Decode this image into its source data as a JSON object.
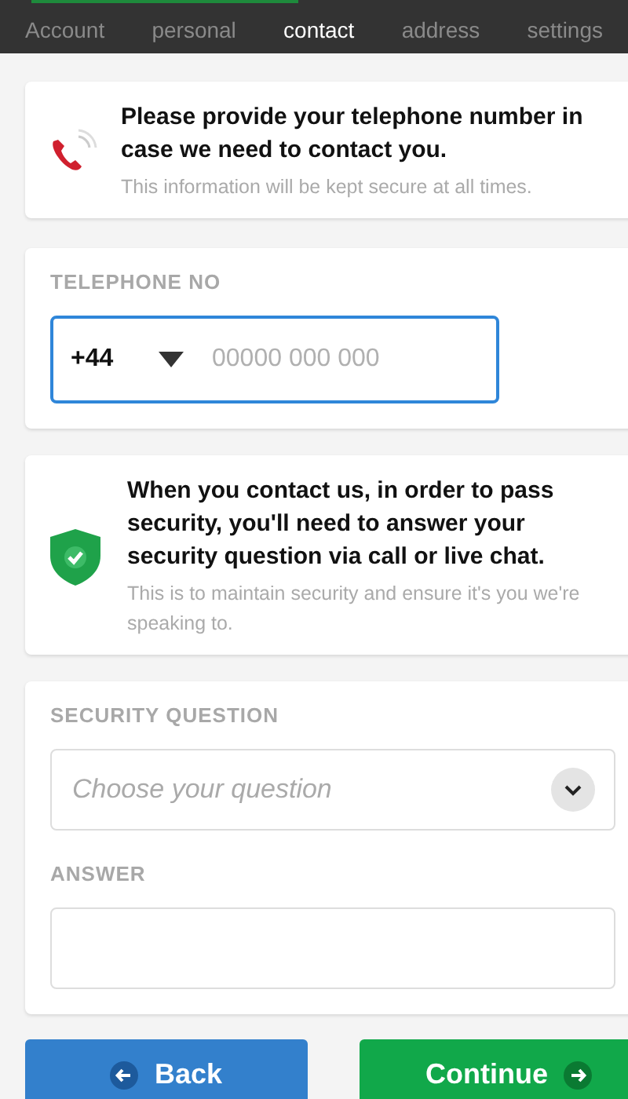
{
  "tabs": [
    {
      "label": "Account",
      "selected": false
    },
    {
      "label": "personal",
      "selected": false
    },
    {
      "label": "contact",
      "selected": true
    },
    {
      "label": "address",
      "selected": false
    },
    {
      "label": "settings",
      "selected": false
    }
  ],
  "phone_notice": {
    "title": "Please provide your telephone number in case we need to contact you.",
    "subtitle": "This information will be kept secure at all times."
  },
  "telephone": {
    "label": "TELEPHONE NO",
    "country_code": "+44",
    "placeholder": "00000 000 000",
    "focused": true
  },
  "security_notice": {
    "title": "When you contact us, in order to pass security, you'll need to answer your security question via call or live chat.",
    "subtitle": "This is to maintain security and ensure it's you we're speaking to."
  },
  "security_question": {
    "label": "SECURITY QUESTION",
    "placeholder": "Choose your question"
  },
  "answer": {
    "label": "ANSWER"
  },
  "buttons": [
    {
      "label": "Back",
      "kind": "back"
    },
    {
      "label": "Continue",
      "kind": "continue"
    }
  ]
}
